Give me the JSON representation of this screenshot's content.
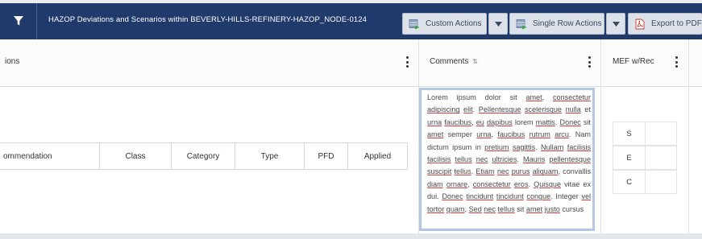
{
  "toolbar": {
    "title": "HAZOP Deviations and Scenarios within BEVERLY-HILLS-REFINERY-HAZOP_NODE-0124",
    "custom_actions_label": "Custom Actions",
    "single_row_actions_label": "Single Row Actions",
    "export_label": "Export to PDF"
  },
  "columns": {
    "recommendations_header": "ions",
    "comments_header": "Comments",
    "comments_sort_glyph": "⇅",
    "mef_header": "MEF w/Rec"
  },
  "inner_table": {
    "headers": [
      "ommendation",
      "Class",
      "Category",
      "Type",
      "PFD",
      "Applied"
    ]
  },
  "comment": {
    "segments": [
      {
        "t": "Lorem ipsum dolor sit ",
        "u": false
      },
      {
        "t": "amet",
        "u": true
      },
      {
        "t": ", ",
        "u": false
      },
      {
        "t": "consectetur",
        "u": true
      },
      {
        "t": " ",
        "u": false
      },
      {
        "t": "adipiscing",
        "u": true
      },
      {
        "t": " ",
        "u": false
      },
      {
        "t": "elit",
        "u": true
      },
      {
        "t": ". ",
        "u": false
      },
      {
        "t": "Pellentesque",
        "u": true
      },
      {
        "t": " ",
        "u": false
      },
      {
        "t": "scelerisque",
        "u": true
      },
      {
        "t": " ",
        "u": false
      },
      {
        "t": "nulla",
        "u": true
      },
      {
        "t": " et ",
        "u": false
      },
      {
        "t": "urna",
        "u": true
      },
      {
        "t": " ",
        "u": false
      },
      {
        "t": "faucibus",
        "u": true
      },
      {
        "t": ", ",
        "u": false
      },
      {
        "t": "eu",
        "u": true
      },
      {
        "t": " ",
        "u": false
      },
      {
        "t": "dapibus",
        "u": true
      },
      {
        "t": " lorem ",
        "u": false
      },
      {
        "t": "mattis",
        "u": true
      },
      {
        "t": ". ",
        "u": false
      },
      {
        "t": "Donec",
        "u": true
      },
      {
        "t": " sit ",
        "u": false
      },
      {
        "t": "amet",
        "u": true
      },
      {
        "t": " semper ",
        "u": false
      },
      {
        "t": "urna",
        "u": true
      },
      {
        "t": ", ",
        "u": false
      },
      {
        "t": "faucibus",
        "u": true
      },
      {
        "t": " ",
        "u": false
      },
      {
        "t": "rutrum",
        "u": true
      },
      {
        "t": " ",
        "u": false
      },
      {
        "t": "arcu",
        "u": true
      },
      {
        "t": ". Nam dictum ipsum in ",
        "u": false
      },
      {
        "t": "pretium",
        "u": true
      },
      {
        "t": " ",
        "u": false
      },
      {
        "t": "sagittis",
        "u": true
      },
      {
        "t": ". ",
        "u": false
      },
      {
        "t": "Nullam",
        "u": true
      },
      {
        "t": " ",
        "u": false
      },
      {
        "t": "facilisis",
        "u": true
      },
      {
        "t": " ",
        "u": false
      },
      {
        "t": "facilisis",
        "u": true
      },
      {
        "t": " ",
        "u": false
      },
      {
        "t": "tellus",
        "u": true
      },
      {
        "t": " ",
        "u": false
      },
      {
        "t": "nec",
        "u": true
      },
      {
        "t": " ",
        "u": false
      },
      {
        "t": "ultricies",
        "u": true
      },
      {
        "t": ". ",
        "u": false
      },
      {
        "t": "Mauris",
        "u": true
      },
      {
        "t": " ",
        "u": false
      },
      {
        "t": "pellentesque",
        "u": true
      },
      {
        "t": " ",
        "u": false
      },
      {
        "t": "suscipit",
        "u": true
      },
      {
        "t": " ",
        "u": false
      },
      {
        "t": "tellus",
        "u": true
      },
      {
        "t": ". ",
        "u": false
      },
      {
        "t": "Etiam",
        "u": true
      },
      {
        "t": " ",
        "u": false
      },
      {
        "t": "nec",
        "u": true
      },
      {
        "t": " ",
        "u": false
      },
      {
        "t": "purus",
        "u": true
      },
      {
        "t": " ",
        "u": false
      },
      {
        "t": "aliquam",
        "u": true
      },
      {
        "t": ", convallis ",
        "u": false
      },
      {
        "t": "diam",
        "u": true
      },
      {
        "t": " ",
        "u": false
      },
      {
        "t": "ornare",
        "u": true
      },
      {
        "t": ", ",
        "u": false
      },
      {
        "t": "consectetur",
        "u": true
      },
      {
        "t": " ",
        "u": false
      },
      {
        "t": "eros",
        "u": true
      },
      {
        "t": ". ",
        "u": false
      },
      {
        "t": "Quisque",
        "u": true
      },
      {
        "t": " vitae ex dui. ",
        "u": false
      },
      {
        "t": "Donec",
        "u": true
      },
      {
        "t": " ",
        "u": false
      },
      {
        "t": "tincidunt",
        "u": true
      },
      {
        "t": " ",
        "u": false
      },
      {
        "t": "tincidunt",
        "u": true
      },
      {
        "t": " ",
        "u": false
      },
      {
        "t": "congue",
        "u": true
      },
      {
        "t": ". Integer ",
        "u": false
      },
      {
        "t": "vel",
        "u": true
      },
      {
        "t": " ",
        "u": false
      },
      {
        "t": "tortor",
        "u": true
      },
      {
        "t": " ",
        "u": false
      },
      {
        "t": "quam",
        "u": true
      },
      {
        "t": ". ",
        "u": false
      },
      {
        "t": "Sed",
        "u": true
      },
      {
        "t": " ",
        "u": false
      },
      {
        "t": "nec",
        "u": true
      },
      {
        "t": " ",
        "u": false
      },
      {
        "t": "tellus",
        "u": true
      },
      {
        "t": " sit ",
        "u": false
      },
      {
        "t": "amet",
        "u": true
      },
      {
        "t": " ",
        "u": false
      },
      {
        "t": "justo",
        "u": true
      },
      {
        "t": " cursus",
        "u": false
      }
    ]
  },
  "mef_grid": {
    "rows": [
      "S",
      "E",
      "C"
    ]
  },
  "colors": {
    "toolbar_bg": "#1f3a6b",
    "button_bg": "#dde2ea",
    "textarea_border": "#b4c8e4",
    "spellcheck": "#d23c3c"
  },
  "icons": {
    "filter": "filter-icon",
    "custom_actions": "table-action-icon",
    "single_row_actions": "table-action-icon",
    "export": "pdf-icon",
    "dropdown": "caret-down-icon",
    "column_menu": "kebab-menu-icon"
  }
}
